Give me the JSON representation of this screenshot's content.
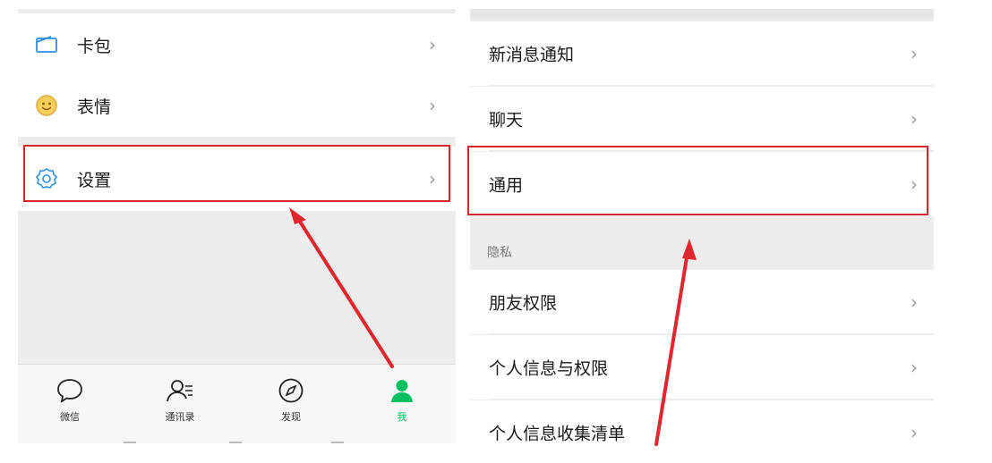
{
  "left_screen": {
    "rows": [
      {
        "label": "卡包",
        "icon": "card-wallet-icon"
      },
      {
        "label": "表情",
        "icon": "emoji-icon"
      },
      {
        "label": "设置",
        "icon": "settings-gear-icon"
      }
    ],
    "chevron": "›",
    "tabs": [
      {
        "label": "微信",
        "icon": "chat-bubble-icon"
      },
      {
        "label": "通讯录",
        "icon": "contacts-icon"
      },
      {
        "label": "发现",
        "icon": "compass-icon"
      },
      {
        "label": "我",
        "icon": "person-icon"
      }
    ],
    "active_tab": "我"
  },
  "right_screen": {
    "rows_top": [
      {
        "label": "新消息通知"
      },
      {
        "label": "聊天"
      },
      {
        "label": "通用"
      }
    ],
    "section_privacy": "隐私",
    "rows_bottom": [
      {
        "label": "朋友权限"
      },
      {
        "label": "个人信息与权限"
      },
      {
        "label": "个人信息收集清单"
      }
    ],
    "chevron": "›"
  },
  "colors": {
    "highlight": "#d7262e",
    "arrow": "#e0262e",
    "active_tab": "#07c160"
  }
}
